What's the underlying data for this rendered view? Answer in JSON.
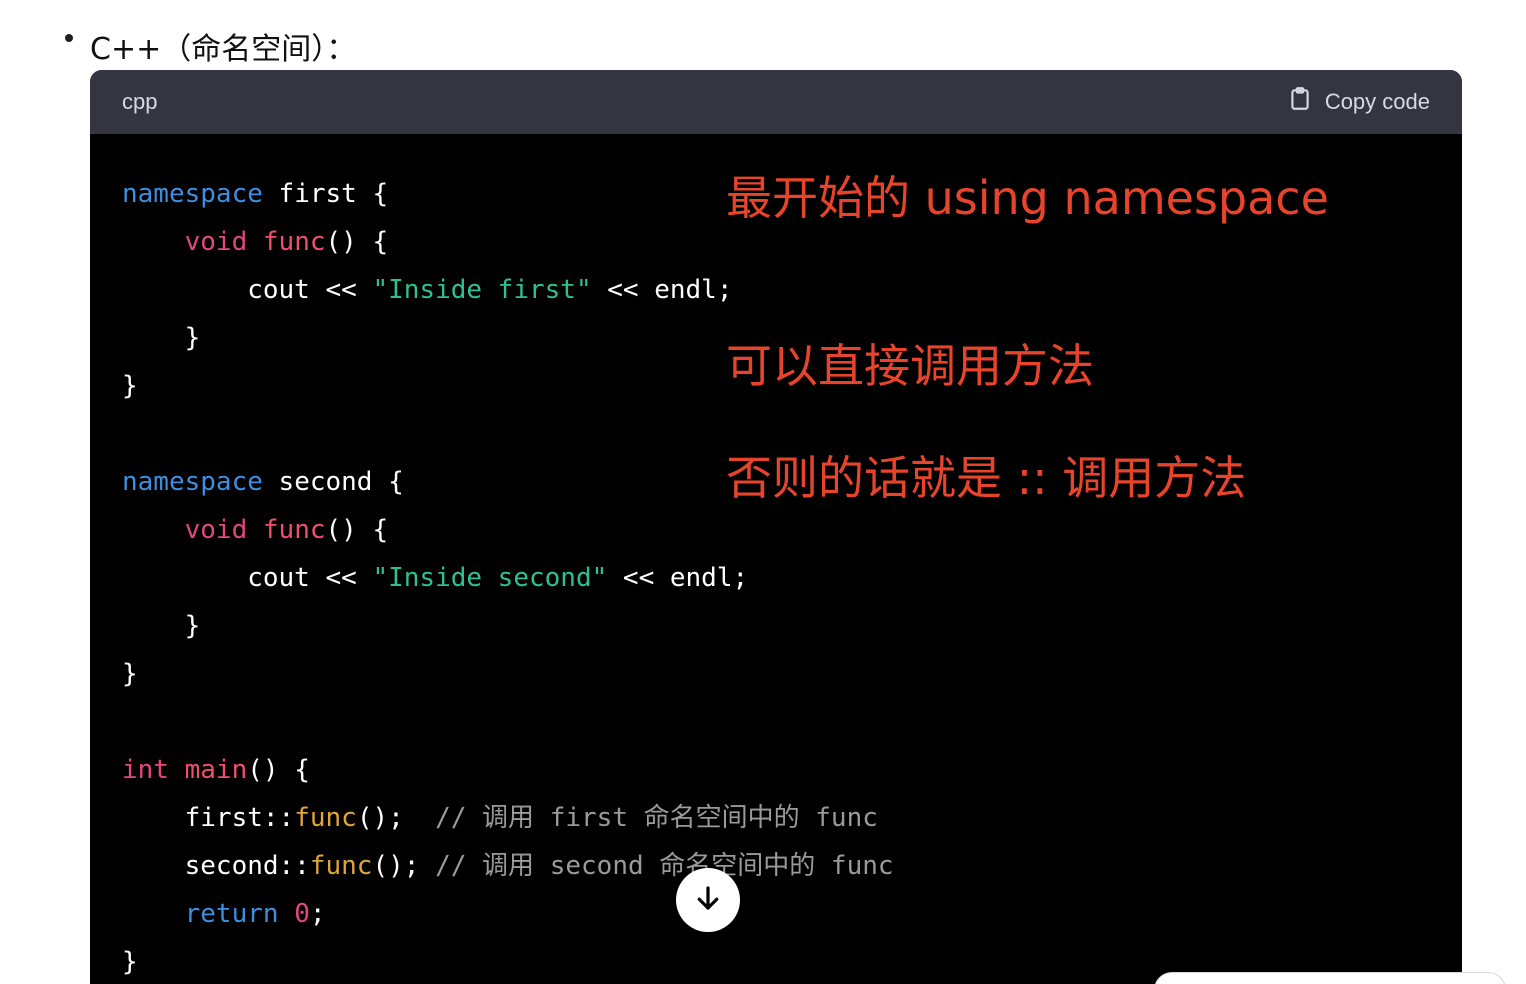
{
  "heading": {
    "text": "C++（命名空间）："
  },
  "code_block": {
    "language": "cpp",
    "copy_label": "Copy code",
    "lines": [
      {
        "tokens": [
          {
            "t": "namespace",
            "c": "kw"
          },
          {
            "t": " first {",
            "c": "plain"
          }
        ]
      },
      {
        "tokens": [
          {
            "t": "    ",
            "c": "plain"
          },
          {
            "t": "void",
            "c": "type"
          },
          {
            "t": " ",
            "c": "plain"
          },
          {
            "t": "func",
            "c": "fn"
          },
          {
            "t": "() {",
            "c": "plain"
          }
        ]
      },
      {
        "tokens": [
          {
            "t": "        cout << ",
            "c": "plain"
          },
          {
            "t": "\"Inside first\"",
            "c": "str"
          },
          {
            "t": " << endl;",
            "c": "plain"
          }
        ]
      },
      {
        "tokens": [
          {
            "t": "    }",
            "c": "plain"
          }
        ]
      },
      {
        "tokens": [
          {
            "t": "}",
            "c": "plain"
          }
        ]
      },
      {
        "tokens": [
          {
            "t": "",
            "c": "plain"
          }
        ]
      },
      {
        "tokens": [
          {
            "t": "namespace",
            "c": "kw"
          },
          {
            "t": " second {",
            "c": "plain"
          }
        ]
      },
      {
        "tokens": [
          {
            "t": "    ",
            "c": "plain"
          },
          {
            "t": "void",
            "c": "type"
          },
          {
            "t": " ",
            "c": "plain"
          },
          {
            "t": "func",
            "c": "fn"
          },
          {
            "t": "() {",
            "c": "plain"
          }
        ]
      },
      {
        "tokens": [
          {
            "t": "        cout << ",
            "c": "plain"
          },
          {
            "t": "\"Inside second\"",
            "c": "str"
          },
          {
            "t": " << endl;",
            "c": "plain"
          }
        ]
      },
      {
        "tokens": [
          {
            "t": "    }",
            "c": "plain"
          }
        ]
      },
      {
        "tokens": [
          {
            "t": "}",
            "c": "plain"
          }
        ]
      },
      {
        "tokens": [
          {
            "t": "",
            "c": "plain"
          }
        ]
      },
      {
        "tokens": [
          {
            "t": "int",
            "c": "type"
          },
          {
            "t": " ",
            "c": "plain"
          },
          {
            "t": "main",
            "c": "fn"
          },
          {
            "t": "() {",
            "c": "plain"
          }
        ]
      },
      {
        "tokens": [
          {
            "t": "    first::",
            "c": "plain"
          },
          {
            "t": "func",
            "c": "call"
          },
          {
            "t": "();  ",
            "c": "plain"
          },
          {
            "t": "// 调用 first 命名空间中的 func",
            "c": "cmt"
          }
        ]
      },
      {
        "tokens": [
          {
            "t": "    second::",
            "c": "plain"
          },
          {
            "t": "func",
            "c": "call"
          },
          {
            "t": "(); ",
            "c": "plain"
          },
          {
            "t": "// 调用 second 命名空间中的 func",
            "c": "cmt"
          }
        ]
      },
      {
        "tokens": [
          {
            "t": "    ",
            "c": "plain"
          },
          {
            "t": "return",
            "c": "kw"
          },
          {
            "t": " ",
            "c": "plain"
          },
          {
            "t": "0",
            "c": "num"
          },
          {
            "t": ";",
            "c": "plain"
          }
        ]
      },
      {
        "tokens": [
          {
            "t": "}",
            "c": "plain"
          }
        ]
      }
    ]
  },
  "annotations": {
    "line1": "最开始的 using namespace",
    "line2": "可以直接调用方法",
    "line3": "否则的话就是 :: 调用方法"
  },
  "icons": {
    "copy": "clipboard-icon",
    "scroll": "arrow-down-icon"
  },
  "colors": {
    "annotation": "#e8432b",
    "code_bg": "#000000",
    "header_bg": "#343541"
  }
}
